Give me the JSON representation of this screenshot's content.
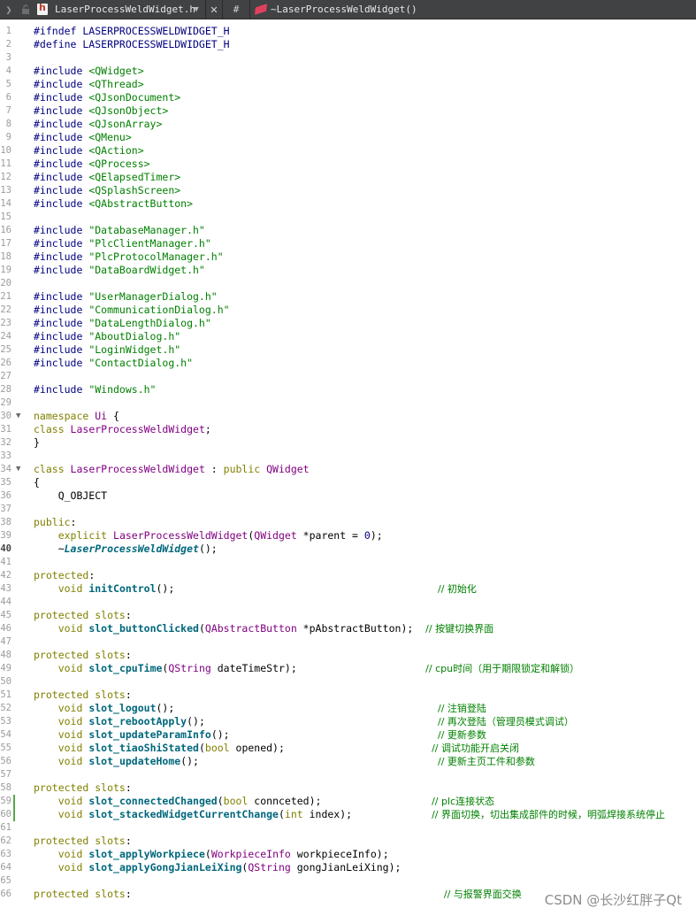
{
  "toolbar": {
    "back_icon": "chevron-left-icon",
    "lock_icon": "lock-icon",
    "file_icon": "header-file-icon",
    "filename": "LaserProcessWeldWidget.h",
    "dropdown_icon": "chevron-down-icon",
    "close_icon": "close-icon",
    "hash_label": "#",
    "symbol_icon": "method-icon",
    "current_symbol": "~LaserProcessWeldWidget()"
  },
  "editor": {
    "current_line": 40,
    "modified_lines": [
      59,
      60
    ],
    "lines": [
      {
        "n": 1,
        "t": [
          [
            "pp",
            "#ifndef LASERPROCESSWELDWIDGET_H"
          ]
        ]
      },
      {
        "n": 2,
        "t": [
          [
            "pp",
            "#define LASERPROCESSWELDWIDGET_H"
          ]
        ]
      },
      {
        "n": 3,
        "t": []
      },
      {
        "n": 4,
        "t": [
          [
            "pp",
            "#include "
          ],
          [
            "str",
            "<QWidget>"
          ]
        ]
      },
      {
        "n": 5,
        "t": [
          [
            "pp",
            "#include "
          ],
          [
            "str",
            "<QThread>"
          ]
        ]
      },
      {
        "n": 6,
        "t": [
          [
            "pp",
            "#include "
          ],
          [
            "str",
            "<QJsonDocument>"
          ]
        ]
      },
      {
        "n": 7,
        "t": [
          [
            "pp",
            "#include "
          ],
          [
            "str",
            "<QJsonObject>"
          ]
        ]
      },
      {
        "n": 8,
        "t": [
          [
            "pp",
            "#include "
          ],
          [
            "str",
            "<QJsonArray>"
          ]
        ]
      },
      {
        "n": 9,
        "t": [
          [
            "pp",
            "#include "
          ],
          [
            "str",
            "<QMenu>"
          ]
        ]
      },
      {
        "n": 10,
        "t": [
          [
            "pp",
            "#include "
          ],
          [
            "str",
            "<QAction>"
          ]
        ]
      },
      {
        "n": 11,
        "t": [
          [
            "pp",
            "#include "
          ],
          [
            "str",
            "<QProcess>"
          ]
        ]
      },
      {
        "n": 12,
        "t": [
          [
            "pp",
            "#include "
          ],
          [
            "str",
            "<QElapsedTimer>"
          ]
        ]
      },
      {
        "n": 13,
        "t": [
          [
            "pp",
            "#include "
          ],
          [
            "str",
            "<QSplashScreen>"
          ]
        ]
      },
      {
        "n": 14,
        "t": [
          [
            "pp",
            "#include "
          ],
          [
            "str",
            "<QAbstractButton>"
          ]
        ]
      },
      {
        "n": 15,
        "t": []
      },
      {
        "n": 16,
        "t": [
          [
            "pp",
            "#include "
          ],
          [
            "str",
            "\"DatabaseManager.h\""
          ]
        ]
      },
      {
        "n": 17,
        "t": [
          [
            "pp",
            "#include "
          ],
          [
            "str",
            "\"PlcClientManager.h\""
          ]
        ]
      },
      {
        "n": 18,
        "t": [
          [
            "pp",
            "#include "
          ],
          [
            "str",
            "\"PlcProtocolManager.h\""
          ]
        ]
      },
      {
        "n": 19,
        "t": [
          [
            "pp",
            "#include "
          ],
          [
            "str",
            "\"DataBoardWidget.h\""
          ]
        ]
      },
      {
        "n": 20,
        "t": []
      },
      {
        "n": 21,
        "t": [
          [
            "pp",
            "#include "
          ],
          [
            "str",
            "\"UserManagerDialog.h\""
          ]
        ]
      },
      {
        "n": 22,
        "t": [
          [
            "pp",
            "#include "
          ],
          [
            "str",
            "\"CommunicationDialog.h\""
          ]
        ]
      },
      {
        "n": 23,
        "t": [
          [
            "pp",
            "#include "
          ],
          [
            "str",
            "\"DataLengthDialog.h\""
          ]
        ]
      },
      {
        "n": 24,
        "t": [
          [
            "pp",
            "#include "
          ],
          [
            "str",
            "\"AboutDialog.h\""
          ]
        ]
      },
      {
        "n": 25,
        "t": [
          [
            "pp",
            "#include "
          ],
          [
            "str",
            "\"LoginWidget.h\""
          ]
        ]
      },
      {
        "n": 26,
        "t": [
          [
            "pp",
            "#include "
          ],
          [
            "str",
            "\"ContactDialog.h\""
          ]
        ]
      },
      {
        "n": 27,
        "t": []
      },
      {
        "n": 28,
        "t": [
          [
            "pp",
            "#include "
          ],
          [
            "str",
            "\"Windows.h\""
          ]
        ]
      },
      {
        "n": 29,
        "t": []
      },
      {
        "n": 30,
        "fold": true,
        "t": [
          [
            "kw",
            "namespace "
          ],
          [
            "type",
            "Ui"
          ],
          [
            "pl",
            " {"
          ]
        ]
      },
      {
        "n": 31,
        "t": [
          [
            "kw",
            "class "
          ],
          [
            "type",
            "LaserProcessWeldWidget"
          ],
          [
            "pl",
            ";"
          ]
        ]
      },
      {
        "n": 32,
        "t": [
          [
            "pl",
            "}"
          ]
        ]
      },
      {
        "n": 33,
        "t": []
      },
      {
        "n": 34,
        "fold": true,
        "t": [
          [
            "kw",
            "class "
          ],
          [
            "type",
            "LaserProcessWeldWidget"
          ],
          [
            "pl",
            " : "
          ],
          [
            "kw",
            "public "
          ],
          [
            "type",
            "QWidget"
          ]
        ]
      },
      {
        "n": 35,
        "t": [
          [
            "pl",
            "{"
          ]
        ]
      },
      {
        "n": 36,
        "t": [
          [
            "pl",
            "    Q_OBJECT"
          ]
        ]
      },
      {
        "n": 37,
        "t": []
      },
      {
        "n": 38,
        "t": [
          [
            "kw",
            "public"
          ],
          [
            "pl",
            ":"
          ]
        ]
      },
      {
        "n": 39,
        "t": [
          [
            "pl",
            "    "
          ],
          [
            "kw",
            "explicit "
          ],
          [
            "type",
            "LaserProcessWeldWidget"
          ],
          [
            "pl",
            "("
          ],
          [
            "type",
            "QWidget"
          ],
          [
            "pl",
            " *parent = "
          ],
          [
            "num",
            "0"
          ],
          [
            "pl",
            ");"
          ]
        ]
      },
      {
        "n": 40,
        "t": [
          [
            "pl",
            "    ~"
          ],
          [
            "dtor",
            "LaserProcessWeldWidget"
          ],
          [
            "pl",
            "();"
          ]
        ]
      },
      {
        "n": 41,
        "t": []
      },
      {
        "n": 42,
        "t": [
          [
            "kw",
            "protected"
          ],
          [
            "pl",
            ":"
          ]
        ]
      },
      {
        "n": 43,
        "t": [
          [
            "pl",
            "    "
          ],
          [
            "kw",
            "void "
          ],
          [
            "fn",
            "initControl"
          ],
          [
            "pl",
            "();                                           "
          ],
          [
            "cm",
            "// 初始化"
          ]
        ]
      },
      {
        "n": 44,
        "t": []
      },
      {
        "n": 45,
        "t": [
          [
            "kw",
            "protected slots"
          ],
          [
            "pl",
            ":"
          ]
        ]
      },
      {
        "n": 46,
        "t": [
          [
            "pl",
            "    "
          ],
          [
            "kw",
            "void "
          ],
          [
            "fn",
            "slot_buttonClicked"
          ],
          [
            "pl",
            "("
          ],
          [
            "type",
            "QAbstractButton"
          ],
          [
            "pl",
            " *pAbstractButton);  "
          ],
          [
            "cm",
            "// 按键切换界面"
          ]
        ]
      },
      {
        "n": 47,
        "t": []
      },
      {
        "n": 48,
        "t": [
          [
            "kw",
            "protected slots"
          ],
          [
            "pl",
            ":"
          ]
        ]
      },
      {
        "n": 49,
        "t": [
          [
            "pl",
            "    "
          ],
          [
            "kw",
            "void "
          ],
          [
            "fn",
            "slot_cpuTime"
          ],
          [
            "pl",
            "("
          ],
          [
            "type",
            "QString"
          ],
          [
            "pl",
            " dateTimeStr);                     "
          ],
          [
            "cm",
            "// cpu时间（用于期限锁定和解锁）"
          ]
        ]
      },
      {
        "n": 50,
        "t": []
      },
      {
        "n": 51,
        "t": [
          [
            "kw",
            "protected slots"
          ],
          [
            "pl",
            ":"
          ]
        ]
      },
      {
        "n": 52,
        "t": [
          [
            "pl",
            "    "
          ],
          [
            "kw",
            "void "
          ],
          [
            "fn",
            "slot_logout"
          ],
          [
            "pl",
            "();                                           "
          ],
          [
            "cm",
            "// 注销登陆"
          ]
        ]
      },
      {
        "n": 53,
        "t": [
          [
            "pl",
            "    "
          ],
          [
            "kw",
            "void "
          ],
          [
            "fn",
            "slot_rebootApply"
          ],
          [
            "pl",
            "();                                      "
          ],
          [
            "cm",
            "// 再次登陆（管理员模式调试）"
          ]
        ]
      },
      {
        "n": 54,
        "t": [
          [
            "pl",
            "    "
          ],
          [
            "kw",
            "void "
          ],
          [
            "fn",
            "slot_updateParamInfo"
          ],
          [
            "pl",
            "();                                  "
          ],
          [
            "cm",
            "// 更新参数"
          ]
        ]
      },
      {
        "n": 55,
        "t": [
          [
            "pl",
            "    "
          ],
          [
            "kw",
            "void "
          ],
          [
            "fn",
            "slot_tiaoShiStated"
          ],
          [
            "pl",
            "("
          ],
          [
            "kw",
            "bool"
          ],
          [
            "pl",
            " opened);                        "
          ],
          [
            "cm",
            "// 调试功能开启关闭"
          ]
        ]
      },
      {
        "n": 56,
        "t": [
          [
            "pl",
            "    "
          ],
          [
            "kw",
            "void "
          ],
          [
            "fn",
            "slot_updateHome"
          ],
          [
            "pl",
            "();                                       "
          ],
          [
            "cm",
            "// 更新主页工件和参数"
          ]
        ]
      },
      {
        "n": 57,
        "t": []
      },
      {
        "n": 58,
        "t": [
          [
            "kw",
            "protected slots"
          ],
          [
            "pl",
            ":"
          ]
        ]
      },
      {
        "n": 59,
        "t": [
          [
            "pl",
            "    "
          ],
          [
            "kw",
            "void "
          ],
          [
            "fn",
            "slot_connectedChanged"
          ],
          [
            "pl",
            "("
          ],
          [
            "kw",
            "bool"
          ],
          [
            "pl",
            " connceted);                  "
          ],
          [
            "cm",
            "// plc连接状态"
          ]
        ]
      },
      {
        "n": 60,
        "t": [
          [
            "pl",
            "    "
          ],
          [
            "kw",
            "void "
          ],
          [
            "fn",
            "slot_stackedWidgetCurrentChange"
          ],
          [
            "pl",
            "("
          ],
          [
            "kw",
            "int"
          ],
          [
            "pl",
            " index);             "
          ],
          [
            "cm",
            "// 界面切换，切出集成部件的时候，明弧焊接系统停止"
          ]
        ]
      },
      {
        "n": 61,
        "t": []
      },
      {
        "n": 62,
        "t": [
          [
            "kw",
            "protected slots"
          ],
          [
            "pl",
            ":"
          ]
        ]
      },
      {
        "n": 63,
        "t": [
          [
            "pl",
            "    "
          ],
          [
            "kw",
            "void "
          ],
          [
            "fn",
            "slot_applyWorkpiece"
          ],
          [
            "pl",
            "("
          ],
          [
            "type",
            "WorkpieceInfo"
          ],
          [
            "pl",
            " workpieceInfo);"
          ]
        ]
      },
      {
        "n": 64,
        "t": [
          [
            "pl",
            "    "
          ],
          [
            "kw",
            "void "
          ],
          [
            "fn",
            "slot_applyGongJianLeiXing"
          ],
          [
            "pl",
            "("
          ],
          [
            "type",
            "QString"
          ],
          [
            "pl",
            " gongJianLeiXing);"
          ]
        ]
      },
      {
        "n": 65,
        "t": []
      },
      {
        "n": 66,
        "t": [
          [
            "kw",
            "protected slots"
          ],
          [
            "pl",
            ":                                                   "
          ],
          [
            "cm",
            "// 与报警界面交换"
          ]
        ]
      }
    ]
  },
  "watermark": "CSDN @长沙红胖子Qt"
}
